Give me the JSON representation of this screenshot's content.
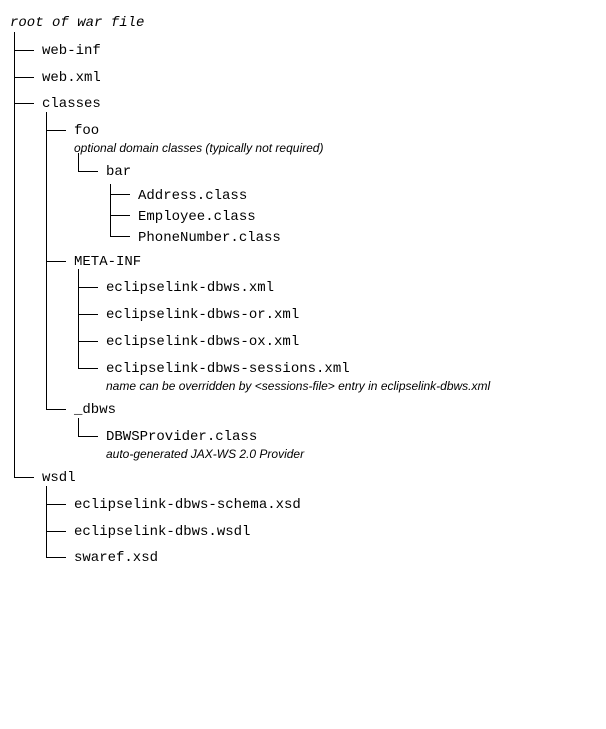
{
  "root": "root of war file",
  "web_inf": "web-inf",
  "web_xml": "web.xml",
  "classes": {
    "label": "classes",
    "foo": {
      "label": "foo",
      "note": "optional domain classes (typically not required)",
      "bar": {
        "label": "bar",
        "items": [
          "Address.class",
          "Employee.class",
          "PhoneNumber.class"
        ]
      }
    },
    "meta_inf": {
      "label": "META-INF",
      "f1": "eclipselink-dbws.xml",
      "f2": "eclipselink-dbws-or.xml",
      "f3": "eclipselink-dbws-ox.xml",
      "f4": "eclipselink-dbws-sessions.xml",
      "f4_note": "name can be overridden by <sessions-file> entry in eclipselink-dbws.xml"
    },
    "dbws": {
      "label": "_dbws",
      "provider": "DBWSProvider.class",
      "provider_note": "auto-generated JAX-WS 2.0 Provider"
    }
  },
  "wsdl": {
    "label": "wsdl",
    "f1": "eclipselink-dbws-schema.xsd",
    "f2": "eclipselink-dbws.wsdl",
    "f3": "swaref.xsd"
  }
}
